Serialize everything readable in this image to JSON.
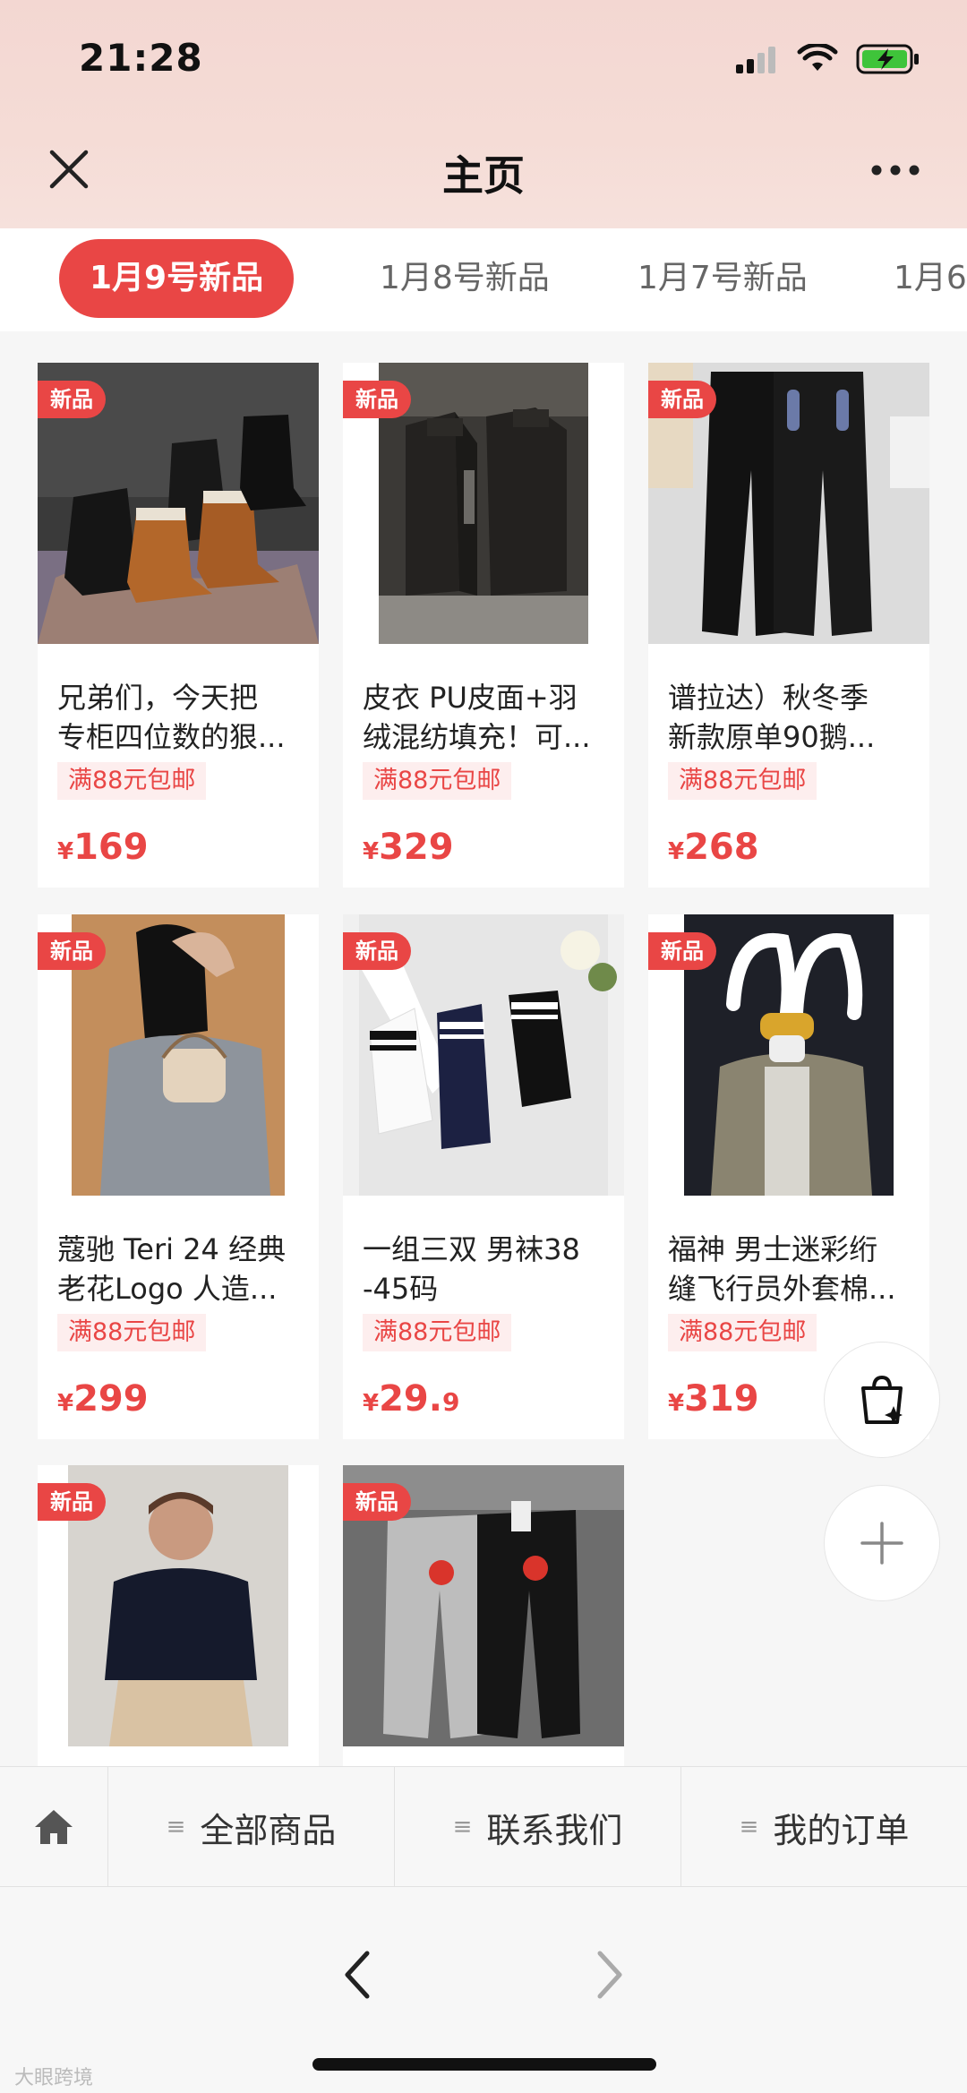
{
  "status": {
    "time": "21:28"
  },
  "header": {
    "title": "主页"
  },
  "tabs": [
    "1月9号新品",
    "1月8号新品",
    "1月7号新品",
    "1月6"
  ],
  "badge_label": "新品",
  "products": [
    {
      "title1": "兄弟们，今天把",
      "title2": "专柜四位数的狠...",
      "shipping": "满88元包邮",
      "price_currency": "¥",
      "price_int": "169",
      "price_dec": ""
    },
    {
      "title1": "皮衣 PU皮面+羽",
      "title2": "绒混纺填充！可...",
      "shipping": "满88元包邮",
      "price_currency": "¥",
      "price_int": "329",
      "price_dec": ""
    },
    {
      "title1": "谱拉达）秋冬季",
      "title2": "新款原单90鹅...",
      "shipping": "满88元包邮",
      "price_currency": "¥",
      "price_int": "268",
      "price_dec": ""
    },
    {
      "title1": "蔻驰 Teri 24 经典",
      "title2": "老花Logo 人造...",
      "shipping": "满88元包邮",
      "price_currency": "¥",
      "price_int": "299",
      "price_dec": ""
    },
    {
      "title1": "一组三双 男袜38",
      "title2": "-45码",
      "shipping": "满88元包邮",
      "price_currency": "¥",
      "price_int": "29.",
      "price_dec": "9"
    },
    {
      "title1": "福神 男士迷彩绗",
      "title2": "缝飞行员外套棉...",
      "shipping": "满88元包邮",
      "price_currency": "¥",
      "price_int": "319",
      "price_dec": ""
    },
    {
      "title1": "",
      "title2": "",
      "shipping": "",
      "price_currency": "",
      "price_int": "",
      "price_dec": ""
    },
    {
      "title1": "",
      "title2": "",
      "shipping": "",
      "price_currency": "",
      "price_int": "",
      "price_dec": ""
    }
  ],
  "bottom_nav": {
    "all_products": "全部商品",
    "contact_us": "联系我们",
    "my_orders": "我的订单"
  },
  "watermark": "大眼跨境",
  "colors": {
    "accent": "#e94645",
    "header_bg": "#f3d7d2"
  }
}
